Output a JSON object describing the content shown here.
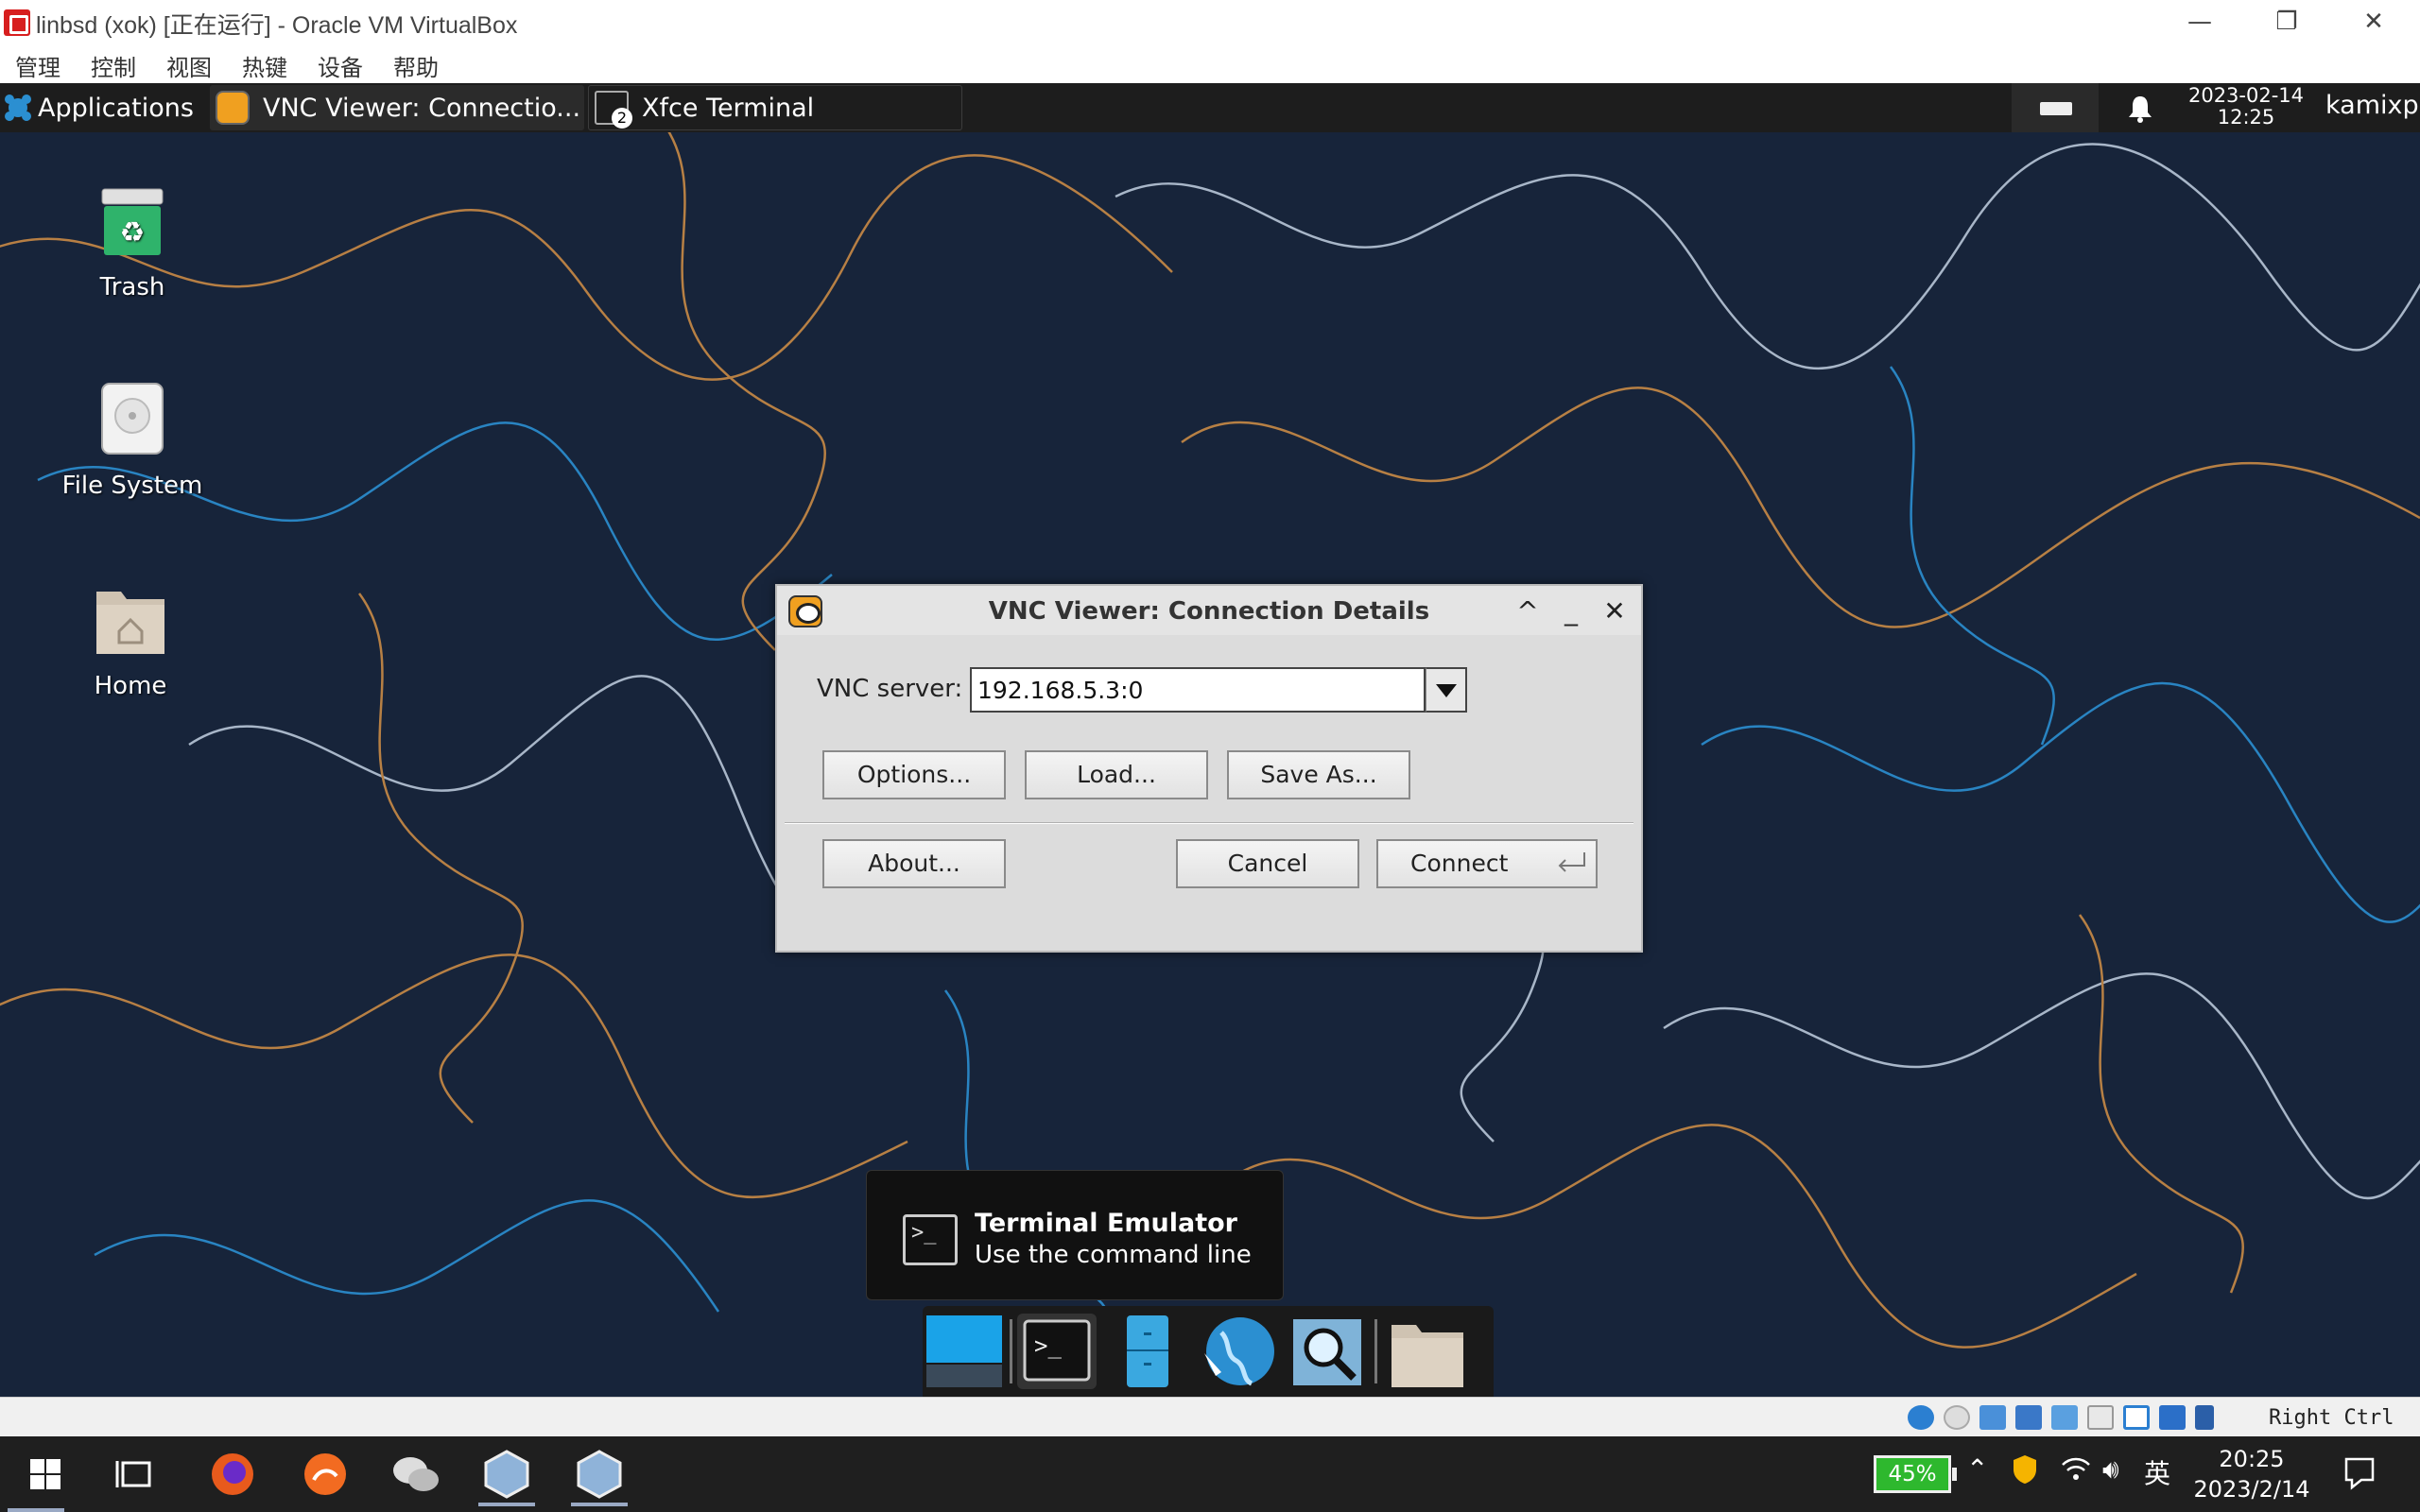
{
  "host_window": {
    "title": "linbsd (xok) [正在运行] - Oracle VM VirtualBox",
    "controls": {
      "minimize": "—",
      "maximize": "❐",
      "close": "✕"
    },
    "menus": [
      "管理",
      "控制",
      "视图",
      "热键",
      "设备",
      "帮助"
    ]
  },
  "xfce_panel": {
    "applications_label": "Applications",
    "tasks": [
      {
        "label": "VNC Viewer: Connectio...",
        "active": true
      },
      {
        "label": "Xfce Terminal",
        "badge": "2",
        "active": false
      }
    ],
    "clock_date": "2023-02-14",
    "clock_time": "12:25",
    "user": "kamixp"
  },
  "desktop_icons": [
    {
      "label": "Trash",
      "icon": "trash-icon"
    },
    {
      "label": "File System",
      "icon": "drive-icon"
    },
    {
      "label": "Home",
      "icon": "home-folder-icon"
    }
  ],
  "vnc_dialog": {
    "title": "VNC Viewer: Connection Details",
    "controls": {
      "shade": "^",
      "minimize": "_",
      "close": "✕"
    },
    "server_label": "VNC server:",
    "server_value": "192.168.5.3:0",
    "buttons": {
      "options": "Options...",
      "load": "Load...",
      "save_as": "Save As...",
      "about": "About...",
      "cancel": "Cancel",
      "connect": "Connect"
    }
  },
  "tooltip": {
    "title": "Terminal Emulator",
    "subtitle": "Use the command line"
  },
  "dock": {
    "items": [
      "desktop-icon",
      "terminal-icon",
      "file-manager-icon",
      "web-browser-icon",
      "app-finder-icon",
      "folder-icon"
    ]
  },
  "vbox_status": {
    "host_key": "Right Ctrl"
  },
  "windows_taskbar": {
    "battery": "45%",
    "ime": "英",
    "time": "20:25",
    "date": "2023/2/14"
  },
  "colors": {
    "wallpaper": "#17243a",
    "contour_orange": "#c98a46",
    "contour_blue": "#2b8fd1",
    "contour_light": "#b8c6d8",
    "xfce_panel": "#1d1d1d",
    "dialog_bg": "#dcdcdc",
    "battery_green": "#2eb82e"
  }
}
